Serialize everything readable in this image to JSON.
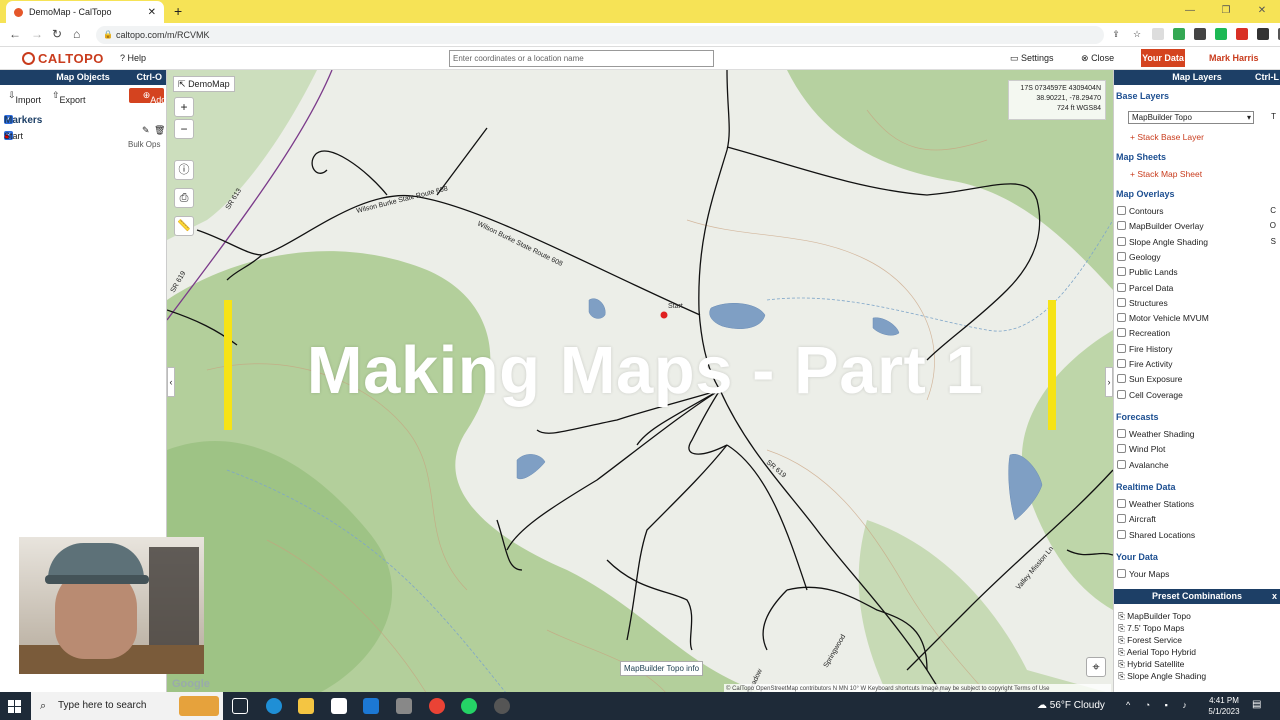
{
  "browser": {
    "tab_title": "DemoMap - CalTopo",
    "tab_close": "✕",
    "new_tab": "+",
    "url": "caltopo.com/m/RCVMK"
  },
  "header": {
    "logo": "CALTOPO",
    "help": "Help",
    "search_placeholder": "Enter coordinates or a location name",
    "settings": "Settings",
    "close": "Close",
    "your_data": "Your Data",
    "user": "Mark Harris"
  },
  "left_panel": {
    "title": "Map Objects",
    "shortcut": "Ctrl-O",
    "import": "Import",
    "export": "Export",
    "add": "Add",
    "markers_heading": "Markers",
    "marker_item": "Start",
    "bulk_ops": "Bulk Ops"
  },
  "map": {
    "map_name": "DemoMap",
    "zoom_in": "+",
    "zoom_out": "−",
    "coord_line1": "17S 0734597E 4309404N",
    "coord_line2": "38.90221, -78.29470",
    "coord_line3": "724 ft    WGS84",
    "overlay_title": "Making Maps - Part 1",
    "marker_label": "Start",
    "road_labels": [
      "Wilson Burke State Route 608",
      "Wilson Burke State Route 608",
      "SR 619",
      "SR 613",
      "SR 619",
      "Valley Mission Ln",
      "Springwood",
      "Meadow"
    ],
    "info_button": "MapBuilder Topo info",
    "attribution": "© CalTopo  OpenStreetMap contributors  N MN 10° W    Keyboard shortcuts    Image may be subject to copyright    Terms of Use",
    "google": "Google",
    "colors": {
      "land": "#eceee8",
      "green": "#a8c98a",
      "road": "#111111",
      "water": "#7f9fc4",
      "accent_bar": "#f6e316"
    }
  },
  "right_panel": {
    "title": "Map Layers",
    "shortcut": "Ctrl-L",
    "base_layers": "Base Layers",
    "base_select": "MapBuilder Topo",
    "base_key": "T",
    "stack_base": "+ Stack Base Layer",
    "map_sheets": "Map Sheets",
    "stack_sheet": "+ Stack Map Sheet",
    "overlays_heading": "Map Overlays",
    "overlays": [
      {
        "label": "Contours",
        "key": "C"
      },
      {
        "label": "MapBuilder Overlay",
        "key": "O"
      },
      {
        "label": "Slope Angle Shading",
        "key": "S"
      },
      {
        "label": "Geology",
        "key": ""
      },
      {
        "label": "Public Lands",
        "key": ""
      },
      {
        "label": "Parcel Data",
        "key": ""
      },
      {
        "label": "Structures",
        "key": ""
      },
      {
        "label": "Motor Vehicle MVUM",
        "key": ""
      },
      {
        "label": "Recreation",
        "key": ""
      },
      {
        "label": "Fire History",
        "key": ""
      },
      {
        "label": "Fire Activity",
        "key": ""
      },
      {
        "label": "Sun Exposure",
        "key": ""
      },
      {
        "label": "Cell Coverage",
        "key": ""
      }
    ],
    "forecasts_heading": "Forecasts",
    "forecasts": [
      "Weather Shading",
      "Wind Plot",
      "Avalanche"
    ],
    "realtime_heading": "Realtime Data",
    "realtime": [
      "Weather Stations",
      "Aircraft",
      "Shared Locations"
    ],
    "yourdata_heading": "Your Data",
    "yourdata": [
      "Your Maps"
    ],
    "preset_title": "Preset Combinations",
    "preset_close": "x",
    "presets": [
      "MapBuilder Topo",
      "7.5' Topo Maps",
      "Forest Service",
      "Aerial Topo Hybrid",
      "Hybrid Satellite",
      "Slope Angle Shading"
    ]
  },
  "taskbar": {
    "search": "Type here to search",
    "weather": "56°F  Cloudy",
    "time": "4:41 PM",
    "date": "5/1/2023"
  }
}
